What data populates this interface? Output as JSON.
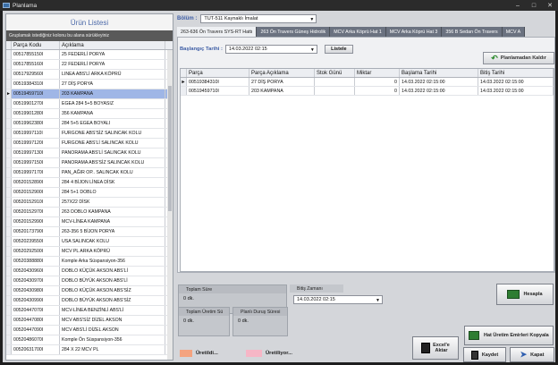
{
  "window": {
    "title": "Planlama"
  },
  "left": {
    "header": "Ürün Listesi",
    "group_hint": "Gruplamak istediğiniz kolonu bu alana sürükleyiniz",
    "columns": [
      "Parça Kodu",
      "Açıklama"
    ],
    "rows": [
      [
        "00517855150I",
        "25 FEDERLİ PORYA"
      ],
      [
        "00517855160I",
        "22 FEDERLİ PORYA"
      ],
      [
        "00517929560I",
        "LINEA ABS'Lİ ARKA KÖPRÜ"
      ],
      [
        "00519384310I",
        "27 DİŞ PORYA"
      ],
      [
        "00519459710I",
        "203 KAMPANA"
      ],
      [
        "00519901270I",
        "EGEA 284 5+5 BOYASIZ"
      ],
      [
        "00519901280I",
        "356 KAMPANA"
      ],
      [
        "00519962380I",
        "284 5+5 EGEA BOYALI"
      ],
      [
        "00519997110I",
        "FURGONE ABS'SİZ SALINCAK KOLU"
      ],
      [
        "00519997120I",
        "FURGONE  ABS'Lİ SALINCAK KOLU"
      ],
      [
        "00519997130I",
        "PANORAMA ABS'Lİ SALINCAK KOLU"
      ],
      [
        "00519997150I",
        "PANORAMA ABS'SİZ SALINCAK KOLU"
      ],
      [
        "00519997170I",
        "PAN_AĞIR OP.. SALINCAK KOLU"
      ],
      [
        "00520152890I",
        "284 4 BİJON LİNEA DİSK"
      ],
      [
        "00520152900I",
        "284 5+1 DOBLO"
      ],
      [
        "00520152910I",
        "257X22 DİSK"
      ],
      [
        "00520152970I",
        "263 DOBLO KAMPANA"
      ],
      [
        "00520152990I",
        "MCV-LİNEA KAMPANA"
      ],
      [
        "00520173790I",
        "263-356 5 BİJON PORYA"
      ],
      [
        "00520239550I",
        "USA SALINCAK KOLU"
      ],
      [
        "00520292500I",
        "MCV PL ARKA KÖPRÜ"
      ],
      [
        "00520388880I",
        "Komple Arka Süspansiyon-356"
      ],
      [
        "00520430960I",
        "DOBLO KÜÇÜK AKSON ABS'Lİ"
      ],
      [
        "00520430970I",
        "DOBLO BÜYÜK AKSON ABS'Lİ"
      ],
      [
        "00520430980I",
        "DOBLO KÜÇÜK AKSON ABS'SİZ"
      ],
      [
        "00520430990I",
        "DOBLO BÜYÜK AKSON ABS'SİZ"
      ],
      [
        "00520447070I",
        "MCV-LİNEA BENZİNLİ ABS'Lİ"
      ],
      [
        "00520447080I",
        "MCV ABS'SİZ DİZEL AKSON"
      ],
      [
        "00520447090I",
        "MCV ABS'Lİ DİZEL AKSON"
      ],
      [
        "00520486070I",
        "Komple Ön Süspansiyon-356"
      ],
      [
        "00520631700I",
        "284 X 22 MCV PL"
      ]
    ],
    "selected_index": 4
  },
  "bolum": {
    "label": "Bölüm :",
    "value": "TUT-511 Kaynaklı İmalat"
  },
  "tabs": [
    "263-636 Ön Travers SYS-RT Hattı",
    "263 Ön Travers Güneş Hidrolik",
    "MCV Arka Köprü Hat 1",
    "MCV Arka Köprü Hat 3",
    "356 B Sedan Ön Travers",
    "MCV A"
  ],
  "toolbar": {
    "start_label": "Başlangıç Tarihi :",
    "start_value": "14.03.2022 02:15",
    "list_button": "Listele",
    "remove_button": "Planlamadan Kaldır"
  },
  "grid": {
    "columns": [
      "Parça",
      "Parça Açıklama",
      "Stok Günü",
      "Miktar",
      "Başlama Tarihi",
      "Bitiş Tarihi"
    ],
    "rows": [
      [
        "00519384310I",
        "27 DİŞ PORYA",
        "",
        "0",
        "14.03.2022 02:15:00",
        "14.03.2022 02:15:00"
      ],
      [
        "00519459710I",
        "203 KAMPANA",
        "",
        "0",
        "14.03.2022 02:15:00",
        "14.03.2022 02:15:00"
      ]
    ]
  },
  "summary": {
    "toplam_sure_label": "Toplam Süre",
    "toplam_sure_value": "0 dk.",
    "bitis_label": "Bitiş Zamanı",
    "bitis_value": "14.03.2022 02:15",
    "uretim_label": "Toplam Üretim Sü",
    "uretim_value": "0 dk.",
    "durus_label": "Planlı Duruş Süresi",
    "durus_value": "0 dk."
  },
  "buttons": {
    "hesapla": "Hesapla",
    "hat_uretim": "Hat Üretim Emirleri Kopyala",
    "excel_1": "Excel'e",
    "excel_2": "Aktar",
    "kaydet": "Kaydet",
    "kapat": "Kapat"
  },
  "legend": {
    "uretildi": "Üretildi...",
    "uretiliyor": "Üretiliyor..."
  },
  "colors": {
    "uretildi": "#f4a37f",
    "uretiliyor": "#f6b6c6",
    "selected_row": "#9fb6e6",
    "accent": "#3d5da5"
  }
}
